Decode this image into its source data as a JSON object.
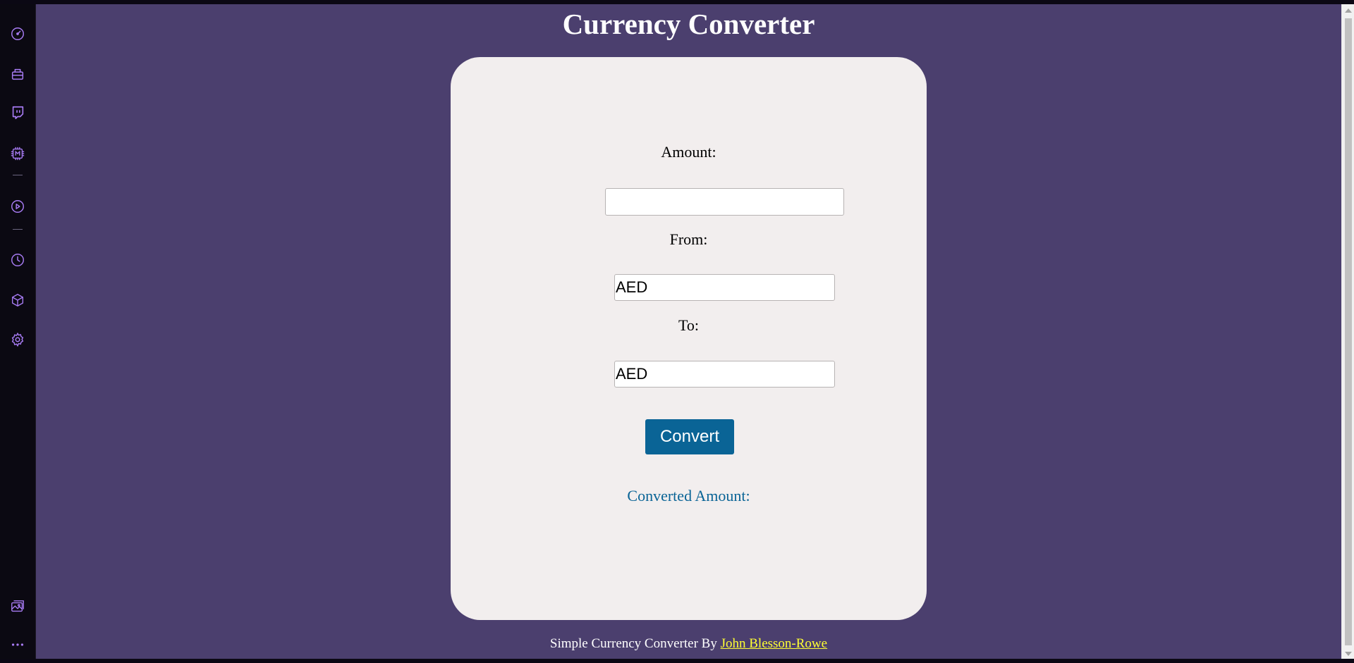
{
  "sidebar": {
    "icons": [
      "speedometer-icon",
      "bag-icon",
      "twitch-icon",
      "chip-icon",
      "play-icon",
      "clock-icon",
      "cube-icon",
      "gear-icon",
      "gallery-icon",
      "more-icon"
    ],
    "accent_color": "#a77bf3"
  },
  "page": {
    "title": "Currency Converter",
    "background": "#4b3f6e"
  },
  "form": {
    "amount_label": "Amount:",
    "amount_value": "",
    "from_label": "From:",
    "from_value": "AED",
    "to_label": "To:",
    "to_value": "AED",
    "convert_label": "Convert",
    "result_label": "Converted Amount:",
    "button_color": "#0a6496"
  },
  "footer": {
    "text": "Simple Currency Converter By",
    "author": "John Blesson-Rowe"
  }
}
